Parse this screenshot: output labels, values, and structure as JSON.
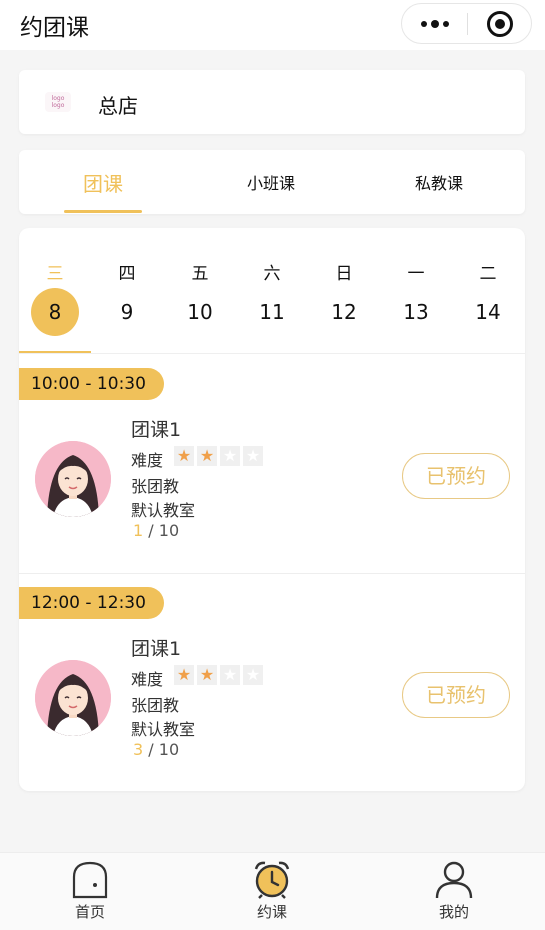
{
  "nav": {
    "title": "约团课",
    "more_icon": "more-dots-icon",
    "close_icon": "close-circle-icon"
  },
  "store": {
    "logo_text": "logo",
    "name": "总店"
  },
  "course_tabs": [
    {
      "label": "团课",
      "active": true
    },
    {
      "label": "小班课",
      "active": false
    },
    {
      "label": "私教课",
      "active": false
    }
  ],
  "days": [
    {
      "weekday": "三",
      "date": "8",
      "active": true
    },
    {
      "weekday": "四",
      "date": "9",
      "active": false
    },
    {
      "weekday": "五",
      "date": "10",
      "active": false
    },
    {
      "weekday": "六",
      "date": "11",
      "active": false
    },
    {
      "weekday": "日",
      "date": "12",
      "active": false
    },
    {
      "weekday": "一",
      "date": "13",
      "active": false
    },
    {
      "weekday": "二",
      "date": "14",
      "active": false
    }
  ],
  "sessions": [
    {
      "time": "10:00 - 10:30",
      "class_name": "团课1",
      "difficulty_label": "难度",
      "difficulty": 2,
      "difficulty_max": 4,
      "coach": "张团教",
      "room": "默认教室",
      "booked": "1",
      "capacity": "/ 10",
      "button": "已预约"
    },
    {
      "time": "12:00 - 12:30",
      "class_name": "团课1",
      "difficulty_label": "难度",
      "difficulty": 2,
      "difficulty_max": 4,
      "coach": "张团教",
      "room": "默认教室",
      "booked": "3",
      "capacity": "/ 10",
      "button": "已预约"
    }
  ],
  "tabbar": [
    {
      "label": "首页",
      "icon": "home-icon"
    },
    {
      "label": "约课",
      "icon": "alarm-clock-icon",
      "active": true
    },
    {
      "label": "我的",
      "icon": "user-icon"
    }
  ],
  "colors": {
    "accent": "#f0c15a",
    "star": "#f0a04a",
    "button_text": "#e8c26e"
  }
}
